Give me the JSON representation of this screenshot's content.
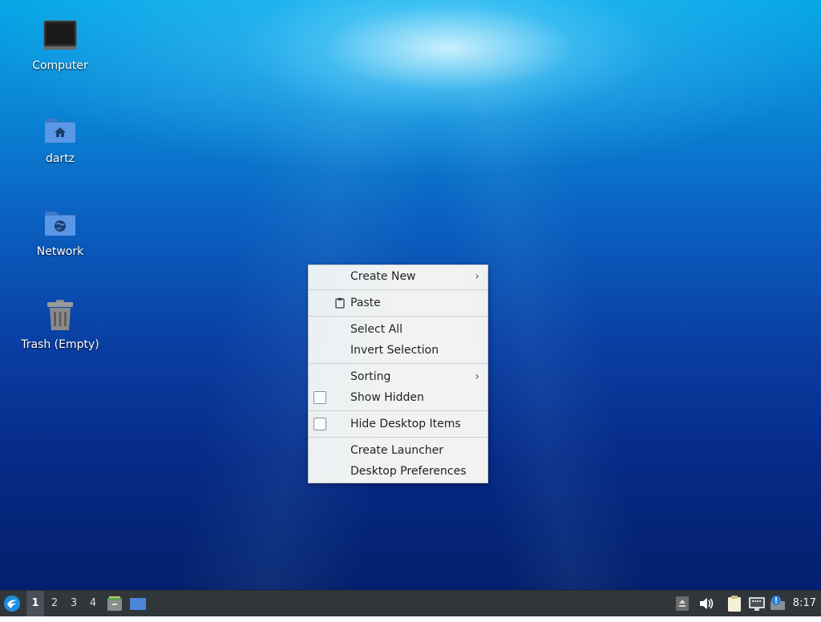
{
  "desktop": {
    "icons": [
      {
        "label": "Computer",
        "icon": "computer-icon"
      },
      {
        "label": "dartz",
        "icon": "home-folder-icon"
      },
      {
        "label": "Network",
        "icon": "network-folder-icon"
      },
      {
        "label": "Trash (Empty)",
        "icon": "trash-icon"
      }
    ]
  },
  "context_menu": {
    "create_new": "Create New",
    "paste": "Paste",
    "select_all": "Select All",
    "invert_selection": "Invert Selection",
    "sorting": "Sorting",
    "show_hidden": "Show Hidden",
    "show_hidden_checked": false,
    "hide_desktop_items": "Hide Desktop Items",
    "hide_desktop_items_checked": false,
    "create_launcher": "Create Launcher",
    "desktop_preferences": "Desktop Preferences"
  },
  "taskbar": {
    "workspaces": [
      "1",
      "2",
      "3",
      "4"
    ],
    "active_workspace": "1",
    "launchers": [
      "file-manager-icon",
      "show-desktop-icon"
    ],
    "tray": [
      "eject-icon",
      "volume-icon",
      "clipboard-icon",
      "network-icon",
      "update-notifier-icon"
    ],
    "clock": "8:17"
  },
  "colors": {
    "taskbar_bg": "#31363b",
    "menu_bg": "#f2f2f2",
    "folder_blue": "#4a86d8"
  }
}
